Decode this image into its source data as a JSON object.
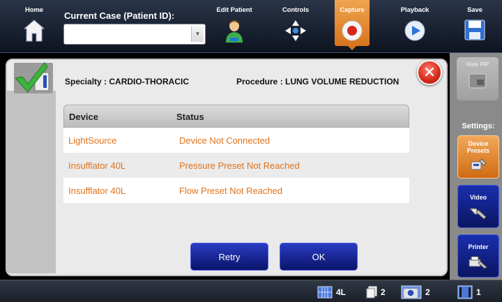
{
  "toolbar": {
    "home_label": "Home",
    "case_label": "Current Case (Patient ID):",
    "case_value": "",
    "edit_patient_label": "Edit Patient",
    "controls_label": "Controls",
    "capture_label": "Capture",
    "playback_label": "Playback",
    "save_label": "Save",
    "active_tab": "Capture"
  },
  "right_panel": {
    "hide_pip_label": "Hide PIP",
    "settings_label": "Settings:",
    "device_presets_label": "Device Presets",
    "video_label": "Video",
    "printer_label": "Printer"
  },
  "dialog": {
    "specialty": "Specialty : CARDIO-THORACIC",
    "procedure": "Procedure : LUNG VOLUME REDUCTION",
    "columns": {
      "device": "Device",
      "status": "Status"
    },
    "rows": [
      {
        "device": "LightSource",
        "status": "Device Not Connected"
      },
      {
        "device": "Insufflator 40L",
        "status": "Pressure Preset Not Reached"
      },
      {
        "device": "Insufflator 40L",
        "status": "Flow Preset Not Reached"
      }
    ],
    "retry_label": "Retry",
    "ok_label": "OK"
  },
  "statusbar": {
    "layout": "4L",
    "images": "2",
    "captures": "2",
    "videos": "1"
  },
  "colors": {
    "accent_orange": "#e0721c",
    "button_blue": "#0a1468",
    "close_red": "#d42a18",
    "check_green": "#3cb43c"
  }
}
